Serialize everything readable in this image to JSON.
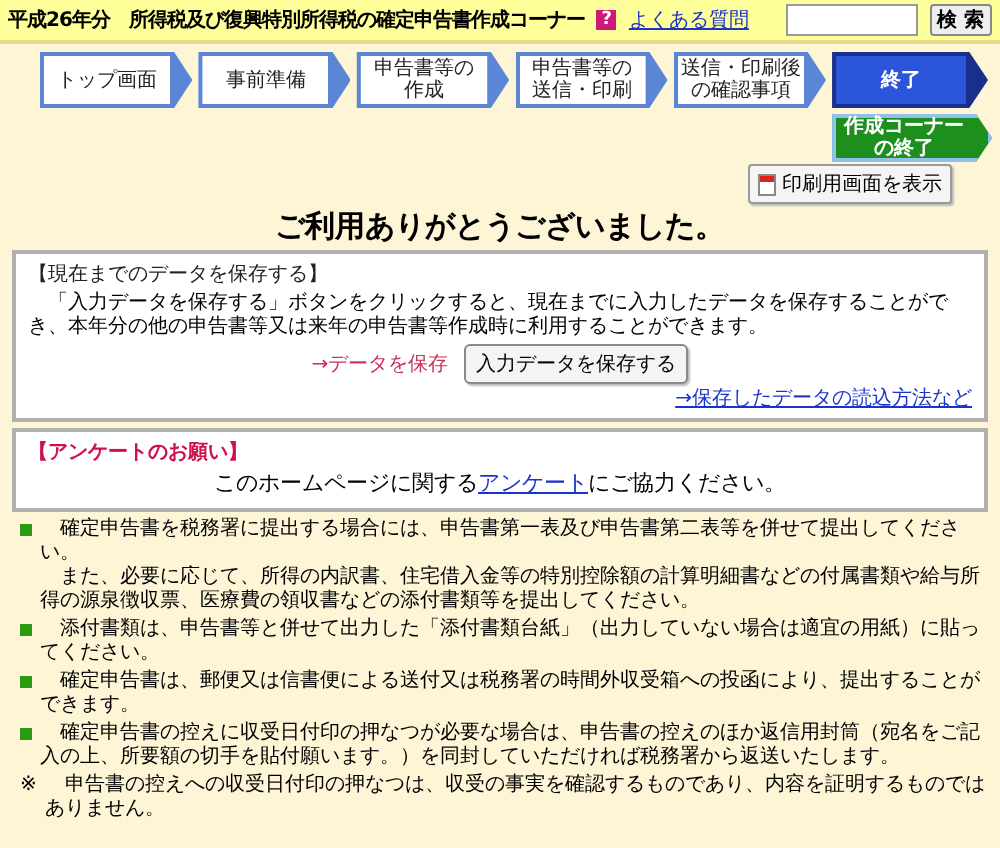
{
  "header": {
    "title": "平成26年分　所得税及び復興特別所得税の確定申告書作成コーナー",
    "help_icon": "?",
    "help_link": "よくある質問",
    "search": {
      "button": "検 索"
    }
  },
  "steps": [
    {
      "lines": [
        "トップ画面"
      ],
      "selected": false
    },
    {
      "lines": [
        "事前準備"
      ],
      "selected": false
    },
    {
      "lines": [
        "申告書等の",
        "作成"
      ],
      "selected": false
    },
    {
      "lines": [
        "申告書等の",
        "送信・印刷"
      ],
      "selected": false
    },
    {
      "lines": [
        "送信・印刷後",
        "の確認事項"
      ],
      "selected": false
    },
    {
      "lines": [
        "終了"
      ],
      "selected": true
    }
  ],
  "exit_button": [
    "作成コーナー",
    "の終了"
  ],
  "print_button": "印刷用画面を表示",
  "heading": "ご利用ありがとうございました。",
  "save_box": {
    "title": "【現在までのデータを保存する】",
    "text": "「入力データを保存する」ボタンをクリックすると、現在までに入力したデータを保存することができ、本年分の他の申告書等又は来年の申告書等作成時に利用することができます。",
    "label": "→データを保存",
    "button": "入力データを保存する",
    "link": "→保存したデータの読込方法など"
  },
  "survey_box": {
    "title": "【アンケートのお願い】",
    "before": "このホームページに関する",
    "link": "アンケート",
    "after": "にご協力ください。"
  },
  "notes": [
    {
      "kind": "bullet",
      "paragraphs": [
        "確定申告書を税務署に提出する場合には、申告書第一表及び申告書第二表等を併せて提出してください。",
        "また、必要に応じて、所得の内訳書、住宅借入金等の特別控除額の計算明細書などの付属書類や給与所得の源泉徴収票、医療費の領収書などの添付書類等を提出してください。"
      ]
    },
    {
      "kind": "bullet",
      "paragraphs": [
        "添付書類は、申告書等と併せて出力した「添付書類台紙」（出力していない場合は適宜の用紙）に貼ってください。"
      ]
    },
    {
      "kind": "bullet",
      "paragraphs": [
        "確定申告書は、郵便又は信書便による送付又は税務署の時間外収受箱への投函により、提出することができます。"
      ]
    },
    {
      "kind": "bullet",
      "paragraphs": [
        "確定申告書の控えに収受日付印の押なつが必要な場合は、申告書の控えのほか返信用封筒（宛名をご記入の上、所要額の切手を貼付願います。）を同封していただければ税務署から返送いたします。"
      ]
    },
    {
      "kind": "note",
      "mark": "※",
      "paragraphs": [
        "申告書の控えへの収受日付印の押なつは、収受の事実を確認するものであり、内容を証明するものではありません。"
      ]
    }
  ]
}
